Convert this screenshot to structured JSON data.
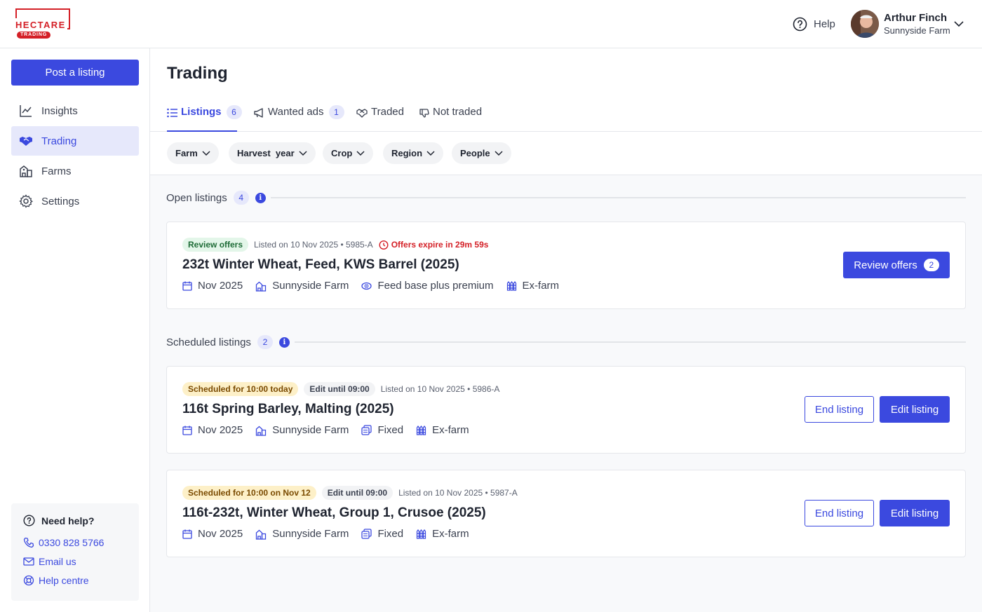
{
  "brand": {
    "name": "HECTARE",
    "sub": "TRADING",
    "color": "#d42027"
  },
  "header": {
    "help_label": "Help",
    "user_name": "Arthur Finch",
    "user_farm": "Sunnyside Farm"
  },
  "sidebar": {
    "post_label": "Post a listing",
    "items": [
      {
        "label": "Insights",
        "icon": "chart-line-icon"
      },
      {
        "label": "Trading",
        "icon": "handshake-icon",
        "active": true
      },
      {
        "label": "Farms",
        "icon": "farm-icon"
      },
      {
        "label": "Settings",
        "icon": "gear-icon"
      }
    ],
    "help": {
      "title": "Need help?",
      "phone": "0330 828 5766",
      "email": "Email us",
      "centre": "Help centre"
    }
  },
  "page": {
    "title": "Trading",
    "tabs": [
      {
        "label": "Listings",
        "count": "6",
        "active": true
      },
      {
        "label": "Wanted ads",
        "count": "1"
      },
      {
        "label": "Traded"
      },
      {
        "label": "Not traded"
      }
    ],
    "filters": [
      "Farm",
      "Harvest  year",
      "Crop",
      "Region",
      "People"
    ]
  },
  "sections": {
    "open": {
      "label": "Open listings",
      "count": "4"
    },
    "scheduled": {
      "label": "Scheduled listings",
      "count": "2"
    }
  },
  "listings": [
    {
      "badge": "Review offers",
      "meta": "Listed on 10 Nov 2025 • 5985-A",
      "expire": "Offers expire in 29m 59s",
      "title": "232t Winter Wheat, Feed, KWS Barrel (2025)",
      "date": "Nov 2025",
      "farm": "Sunnyside Farm",
      "price": "Feed base plus premium",
      "delivery": "Ex-farm",
      "primary_label": "Review offers",
      "primary_count": "2"
    },
    {
      "badge": "Scheduled for 10:00 today",
      "edit_until": "Edit until 09:00",
      "meta": "Listed on 10 Nov 2025 • 5986-A",
      "title": "116t Spring Barley, Malting (2025)",
      "date": "Nov 2025",
      "farm": "Sunnyside Farm",
      "price": "Fixed",
      "delivery": "Ex-farm",
      "end_label": "End listing",
      "edit_label": "Edit listing"
    },
    {
      "badge": "Scheduled for 10:00 on Nov 12",
      "edit_until": "Edit until 09:00",
      "meta": "Listed on 10 Nov 2025 • 5987-A",
      "title": "116t-232t, Winter Wheat, Group 1, Crusoe (2025)",
      "date": "Nov 2025",
      "farm": "Sunnyside Farm",
      "price": "Fixed",
      "delivery": "Ex-farm",
      "end_label": "End listing",
      "edit_label": "Edit listing"
    }
  ],
  "colors": {
    "accent": "#3b49df",
    "accent_bg": "#e6e8fb",
    "danger": "#d42027"
  }
}
